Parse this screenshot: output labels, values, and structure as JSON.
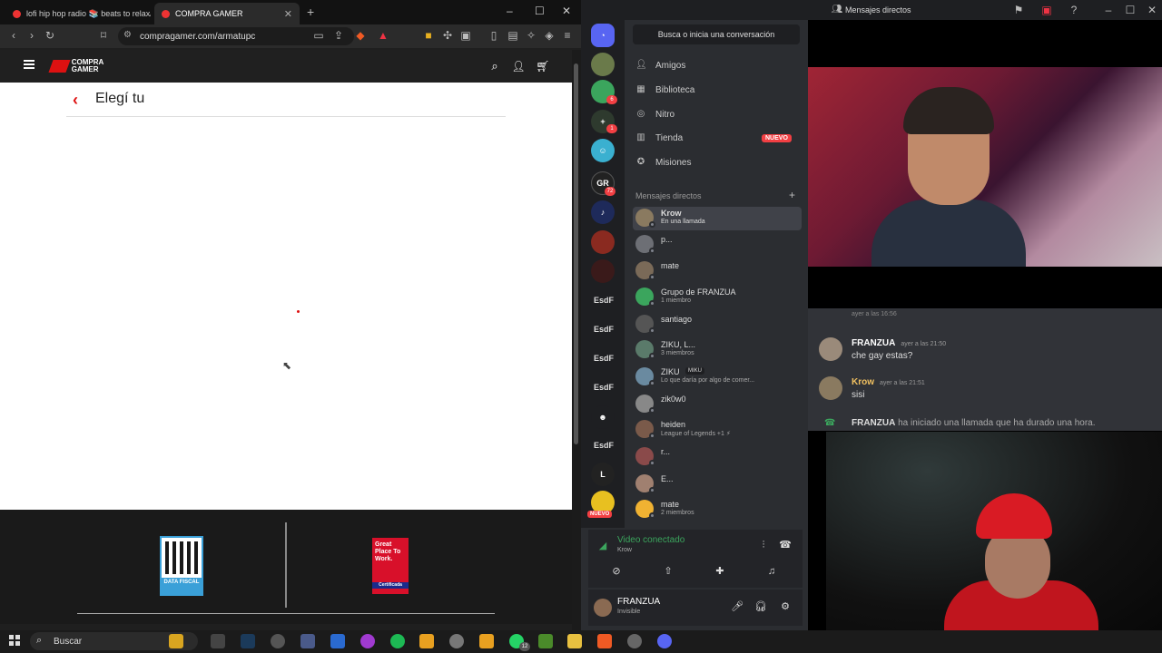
{
  "browser": {
    "tabs": [
      {
        "label": "lofi hip hop radio 📚 beats to relax/s"
      },
      {
        "label": "COMPRA GAMER"
      }
    ],
    "url": "compragamer.com/armatupc",
    "new_tab": "+",
    "site": {
      "logo_text": "COMPRA GAMER",
      "page_title": "Elegí tu",
      "footer": {
        "qr_label": "DATA FISCAL",
        "gptw_text": "Great Place To Work.",
        "gptw_cert": "Certificada"
      }
    }
  },
  "discord": {
    "search_placeholder": "Busca o inicia una conversación",
    "window_title": "Mensajes directos",
    "nav": [
      {
        "label": "Amigos",
        "icon": "friends-icon"
      },
      {
        "label": "Biblioteca",
        "icon": "library-icon"
      },
      {
        "label": "Nitro",
        "icon": "nitro-icon"
      },
      {
        "label": "Tienda",
        "icon": "shop-icon"
      },
      {
        "label": "Misiones",
        "icon": "quests-icon"
      }
    ],
    "nuevo_badge": "NUEVO",
    "dm_header": "Mensajes directos",
    "dms": [
      {
        "name": "Krow",
        "sub": "En una llamada",
        "color": "#8a7a60",
        "selected": true
      },
      {
        "name": "p...",
        "sub": "",
        "color": "#6d6f75"
      },
      {
        "name": "mate",
        "sub": "",
        "color": "#7a6a58"
      },
      {
        "name": "Grupo de FRANZUA",
        "sub": "1 miembro",
        "color": "#3ba55d"
      },
      {
        "name": "santiago",
        "sub": "",
        "color": "#555"
      },
      {
        "name": "ZIKU, L...",
        "sub": "3 miembros",
        "color": "#5a7a6a"
      },
      {
        "name": "ZIKU",
        "sub": "Lo que daría por algo de comer...",
        "color": "#6a8aa0"
      },
      {
        "name": "zik0w0",
        "sub": "",
        "color": "#888"
      },
      {
        "name": "heiden",
        "sub": "League of Legends +1 ⚡",
        "color": "#7a5a4a"
      },
      {
        "name": "r...",
        "sub": "",
        "color": "#8a4a4a"
      },
      {
        "name": "E...",
        "sub": "",
        "color": "#a08070"
      },
      {
        "name": "mate",
        "sub": "2 miembros",
        "color": "#f0b232"
      }
    ],
    "ziku_tag": "MIKU",
    "servers": {
      "esdf": [
        "EsdF",
        "EsdF",
        "EsdF",
        "EsdF",
        "EsdF"
      ],
      "badges": [
        "6",
        "2",
        "1",
        "72",
        "6",
        "1",
        "2"
      ],
      "nuevo": "NUEVO"
    },
    "voice": {
      "title": "Video conectado",
      "channel": "Krow"
    },
    "user": {
      "name": "FRANZUA",
      "status": "Invisible"
    }
  },
  "chat": {
    "earlier_time": "ayer a las 16:56",
    "messages": [
      {
        "author": "FRANZUA",
        "time": "ayer a las 21:50",
        "text": "che gay estas?"
      },
      {
        "author": "Krow",
        "time": "ayer a las 21:51",
        "text": "sisi"
      }
    ],
    "call_author": "FRANZUA",
    "call_text": "ha iniciado una llamada que ha durado una hora."
  },
  "taskbar": {
    "search_label": "Buscar",
    "tray_badge": "12"
  }
}
